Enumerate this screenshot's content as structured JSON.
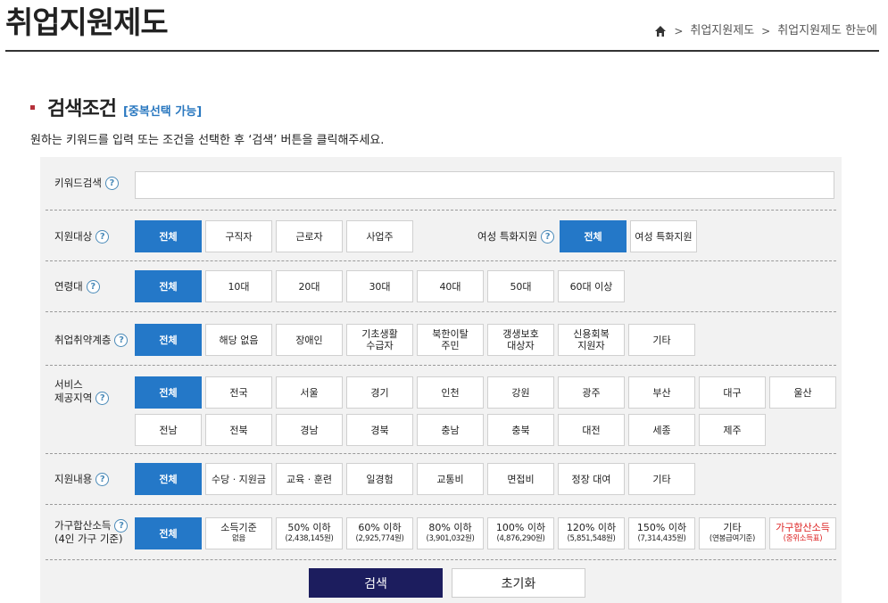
{
  "header": {
    "title": "취업지원제도",
    "breadcrumb": [
      "취업지원제도",
      "취업지원제도 한눈에"
    ],
    "breadcrumb_sep": ">"
  },
  "section": {
    "title": "검색조건",
    "note": "[중복선택 가능]",
    "guide": "원하는 키워드를 입력 또는 조건을 선택한 후 ‘검색’ 버튼을 클릭해주세요."
  },
  "keyword": {
    "label": "키워드검색",
    "value": ""
  },
  "target": {
    "label": "지원대상",
    "options": [
      "전체",
      "구직자",
      "근로자",
      "사업주"
    ],
    "selected": "전체"
  },
  "women": {
    "label": "여성 특화지원",
    "options": [
      "전체",
      "여성 특화지원"
    ],
    "selected": "전체"
  },
  "age": {
    "label": "연령대",
    "options": [
      "전체",
      "10대",
      "20대",
      "30대",
      "40대",
      "50대",
      "60대 이상"
    ],
    "selected": "전체"
  },
  "vulnerable": {
    "label": "취업취약계층",
    "options": [
      "전체",
      "해당 없음",
      "장애인",
      "기초생활\n수급자",
      "북한이탈\n주민",
      "갱생보호\n대상자",
      "신용회복\n지원자",
      "기타"
    ],
    "selected": "전체"
  },
  "region": {
    "label": "서비스\n제공지역",
    "options": [
      "전체",
      "전국",
      "서울",
      "경기",
      "인천",
      "강원",
      "광주",
      "부산",
      "대구",
      "울산",
      "전남",
      "전북",
      "경남",
      "경북",
      "충남",
      "충북",
      "대전",
      "세종",
      "제주"
    ],
    "selected": "전체"
  },
  "content": {
    "label": "지원내용",
    "options": [
      "전체",
      "수당 · 지원금",
      "교육 · 훈련",
      "일경험",
      "교통비",
      "면접비",
      "정장 대여",
      "기타"
    ],
    "selected": "전체"
  },
  "income": {
    "label": "가구합산소득",
    "sublabel": "(4인 가구 기준)",
    "options": [
      {
        "main": "전체",
        "sub": ""
      },
      {
        "main": "소득기준",
        "sub": "없음"
      },
      {
        "main": "50% 이하",
        "sub": "(2,438,145원)"
      },
      {
        "main": "60% 이하",
        "sub": "(2,925,774원)"
      },
      {
        "main": "80% 이하",
        "sub": "(3,901,032원)"
      },
      {
        "main": "100% 이하",
        "sub": "(4,876,290원)"
      },
      {
        "main": "120% 이하",
        "sub": "(5,851,548원)"
      },
      {
        "main": "150% 이하",
        "sub": "(7,314,435원)"
      },
      {
        "main": "기타",
        "sub": "(연봉급여기준)"
      },
      {
        "main": "가구합산소득",
        "sub": "(중위소득표)"
      }
    ],
    "selected": "전체"
  },
  "buttons": {
    "search": "검색",
    "reset": "초기화"
  },
  "colors": {
    "selected": "#2478c8",
    "search_button": "#1c1d5e",
    "note": "#2a78c0",
    "bullet": "#b5303a",
    "link_red": "#dd2222"
  }
}
